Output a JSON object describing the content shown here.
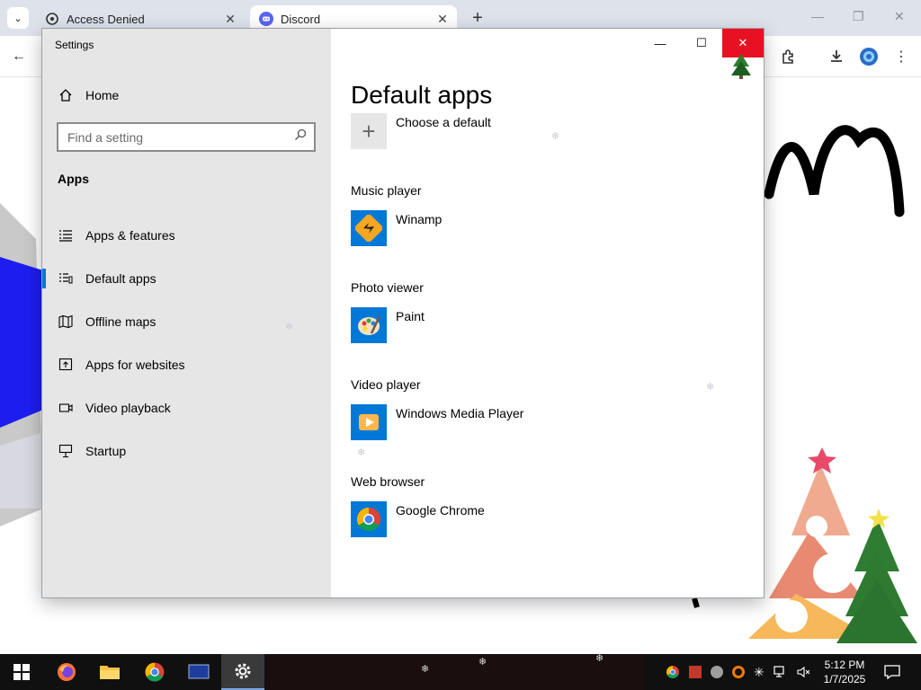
{
  "browser": {
    "tabs": [
      {
        "label": "Access Denied",
        "close": "✕"
      },
      {
        "label": "Discord",
        "close": "✕"
      }
    ],
    "new_tab": "+",
    "menu_chevron": "⌄",
    "win_minimize": "—",
    "win_restore": "❐",
    "win_close": "✕"
  },
  "settings": {
    "title": "Settings",
    "home_label": "Home",
    "search_placeholder": "Find a setting",
    "section": "Apps",
    "nav": [
      {
        "label": "Apps & features",
        "icon": "list-icon"
      },
      {
        "label": "Default apps",
        "icon": "default-apps-icon",
        "selected": true
      },
      {
        "label": "Offline maps",
        "icon": "map-icon"
      },
      {
        "label": "Apps for websites",
        "icon": "link-box-icon"
      },
      {
        "label": "Video playback",
        "icon": "video-icon"
      },
      {
        "label": "Startup",
        "icon": "startup-icon"
      }
    ],
    "window_buttons": {
      "minimize": "—",
      "maximize": "☐",
      "close": "✕"
    }
  },
  "content": {
    "title": "Default apps",
    "choose_default": "Choose a default",
    "categories": [
      {
        "label": "Music player",
        "app": "Winamp",
        "icon": "winamp-icon"
      },
      {
        "label": "Photo viewer",
        "app": "Paint",
        "icon": "paint-icon"
      },
      {
        "label": "Video player",
        "app": "Windows Media Player",
        "icon": "wmp-icon"
      },
      {
        "label": "Web browser",
        "app": "Google Chrome",
        "icon": "chrome-icon"
      }
    ]
  },
  "taskbar": {
    "time": "5:12 PM",
    "date": "1/7/2025"
  },
  "colors": {
    "accent": "#0078d7",
    "close_red": "#e81123",
    "sidebar_bg": "#e6e6e6",
    "taskbar_bg": "#101010"
  }
}
